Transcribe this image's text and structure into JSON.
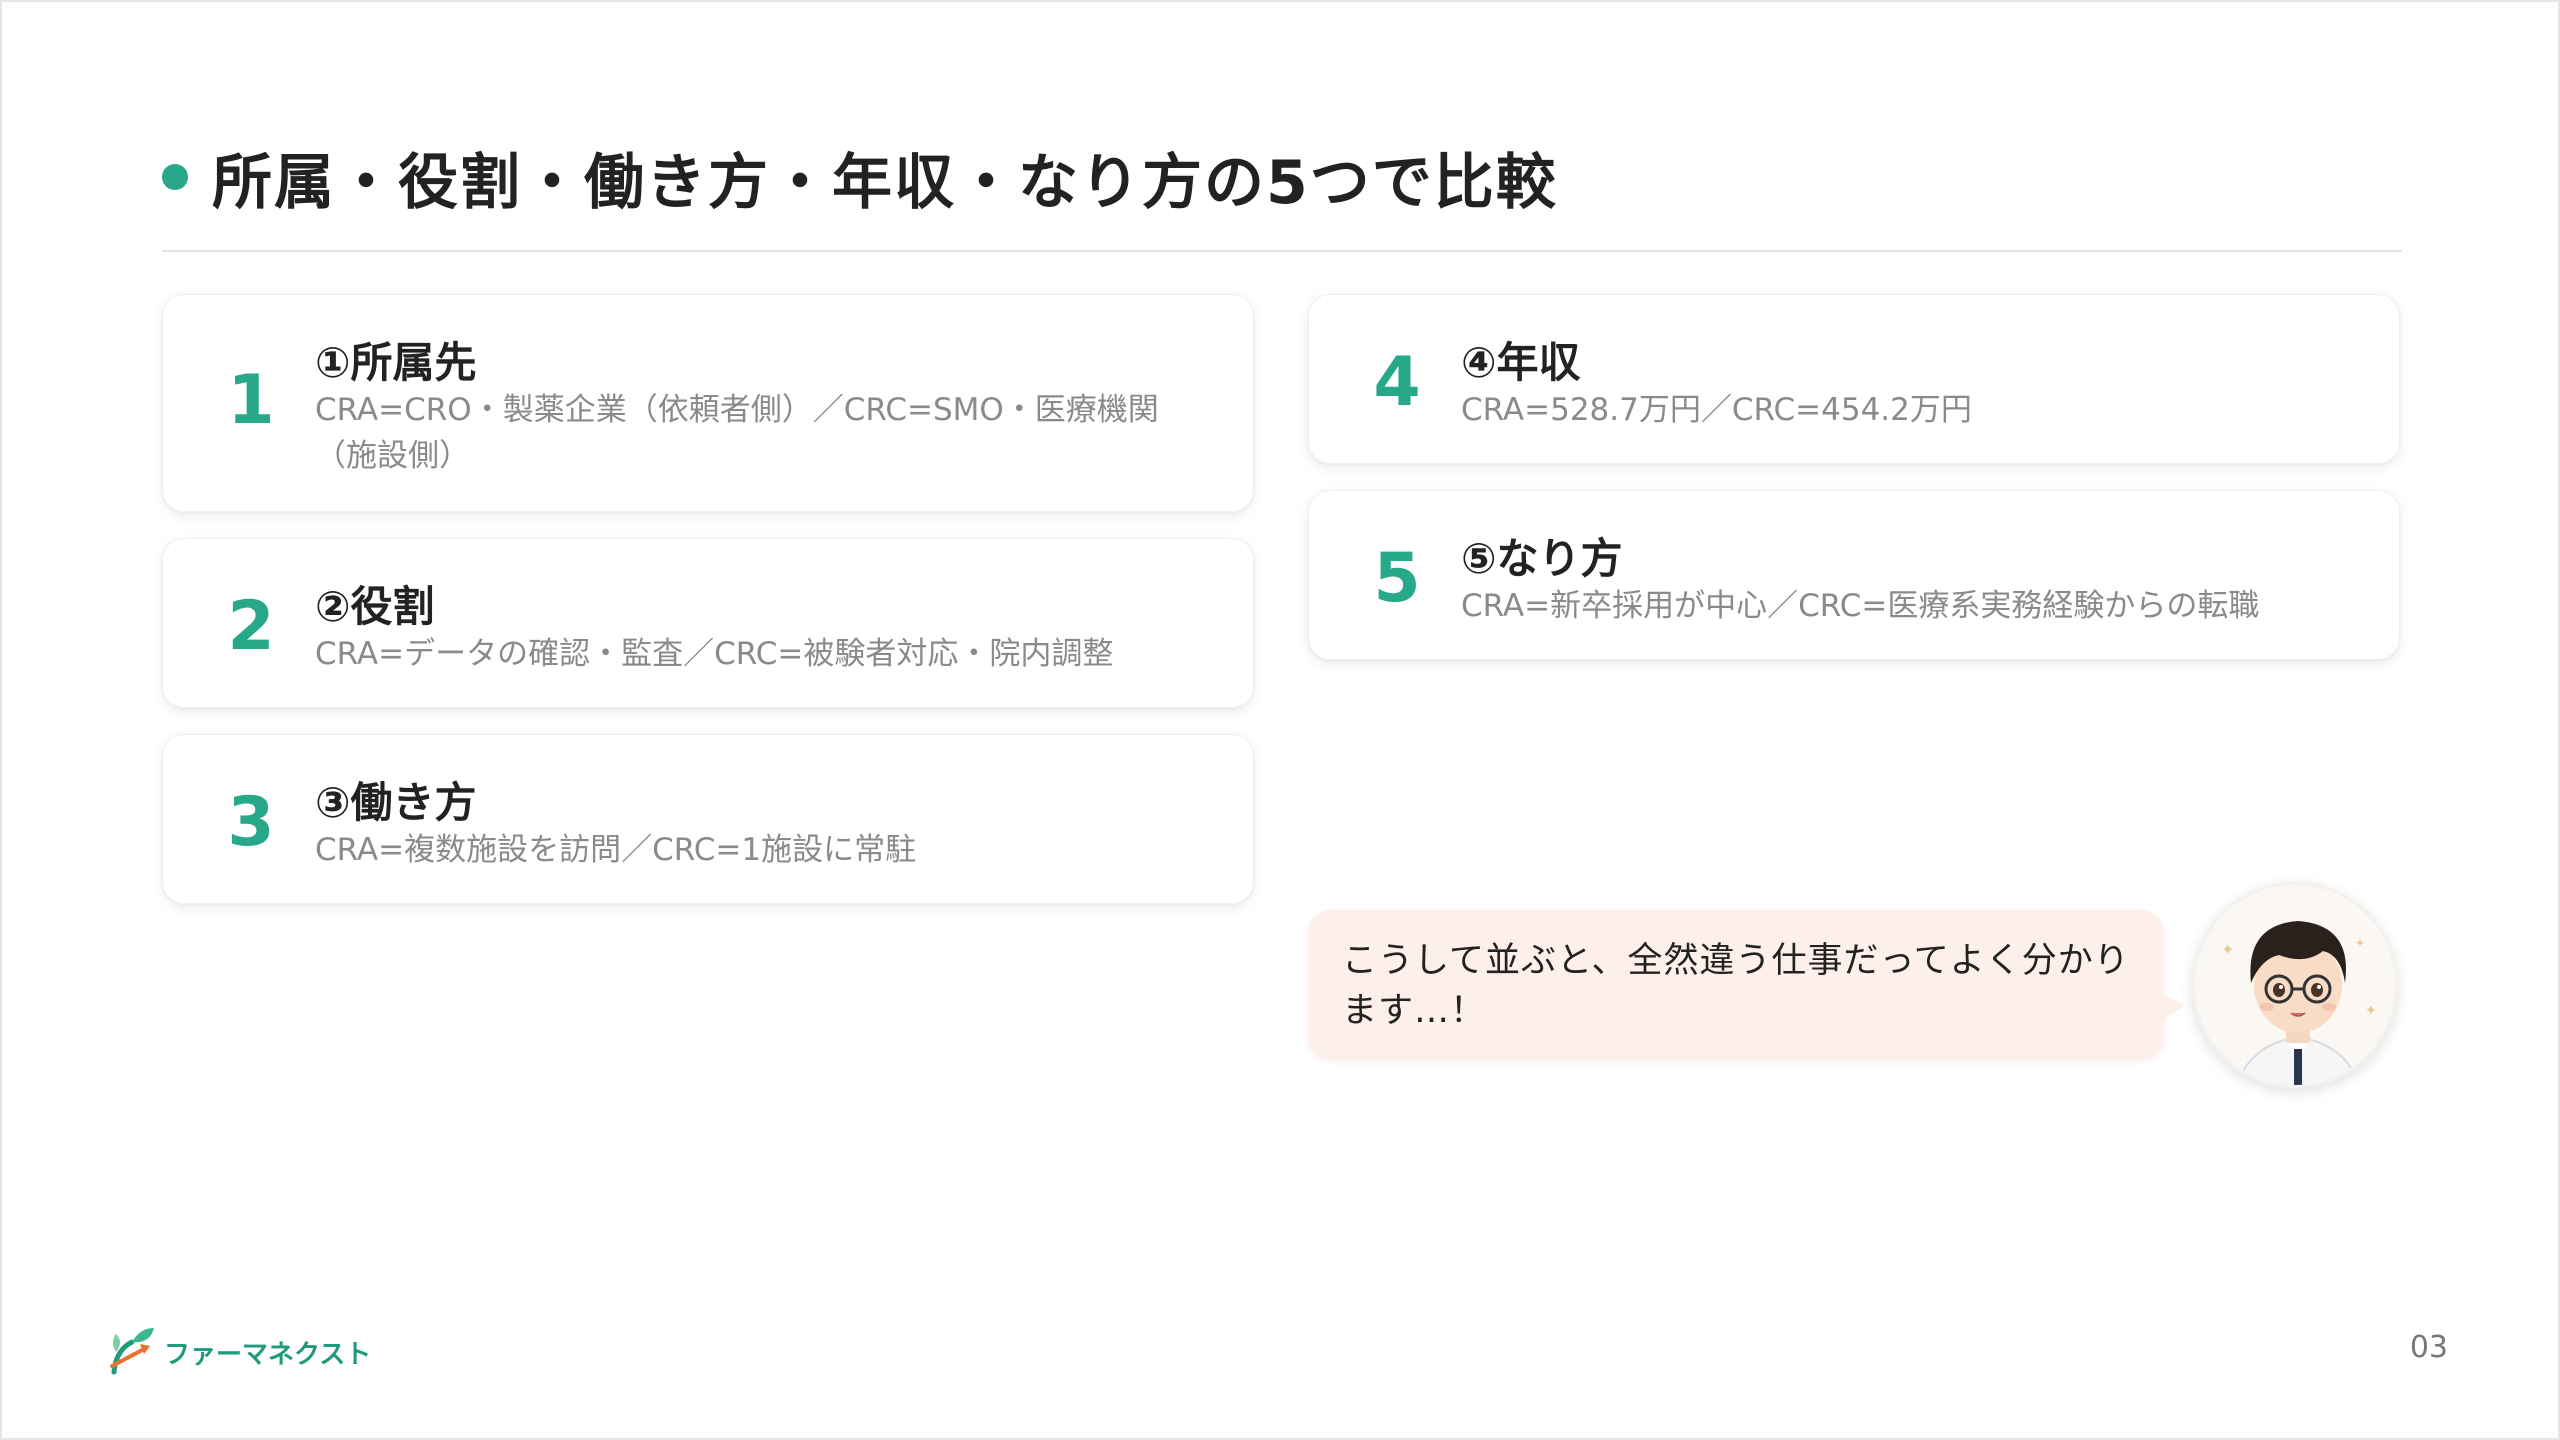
{
  "slide": {
    "title": "所属・役割・働き方・年収・なり方の5つで比較",
    "page_number": "03",
    "accent_color": "#26a889"
  },
  "cards": [
    {
      "number": "1",
      "heading": "①所属先",
      "description": "CRA=CRO・製薬企業（依頼者側）／CRC=SMO・医療機関（施設側）"
    },
    {
      "number": "2",
      "heading": "②役割",
      "description": "CRA=データの確認・監査／CRC=被験者対応・院内調整"
    },
    {
      "number": "3",
      "heading": "③働き方",
      "description": "CRA=複数施設を訪問／CRC=1施設に常駐"
    },
    {
      "number": "4",
      "heading": "④年収",
      "description": "CRA=528.7万円／CRC=454.2万円"
    },
    {
      "number": "5",
      "heading": "⑤なり方",
      "description": "CRA=新卒採用が中心／CRC=医療系実務経験からの転職"
    }
  ],
  "speech": {
    "text": "こうして並ぶと、全然違う仕事だってよく分かります…！",
    "bubble_color": "#fdf0ea"
  },
  "avatar": {
    "icon": "pharmacist-avatar-icon"
  },
  "logo": {
    "text": "ファーマネクスト",
    "icon": "sprout-arrow-logo-icon"
  }
}
